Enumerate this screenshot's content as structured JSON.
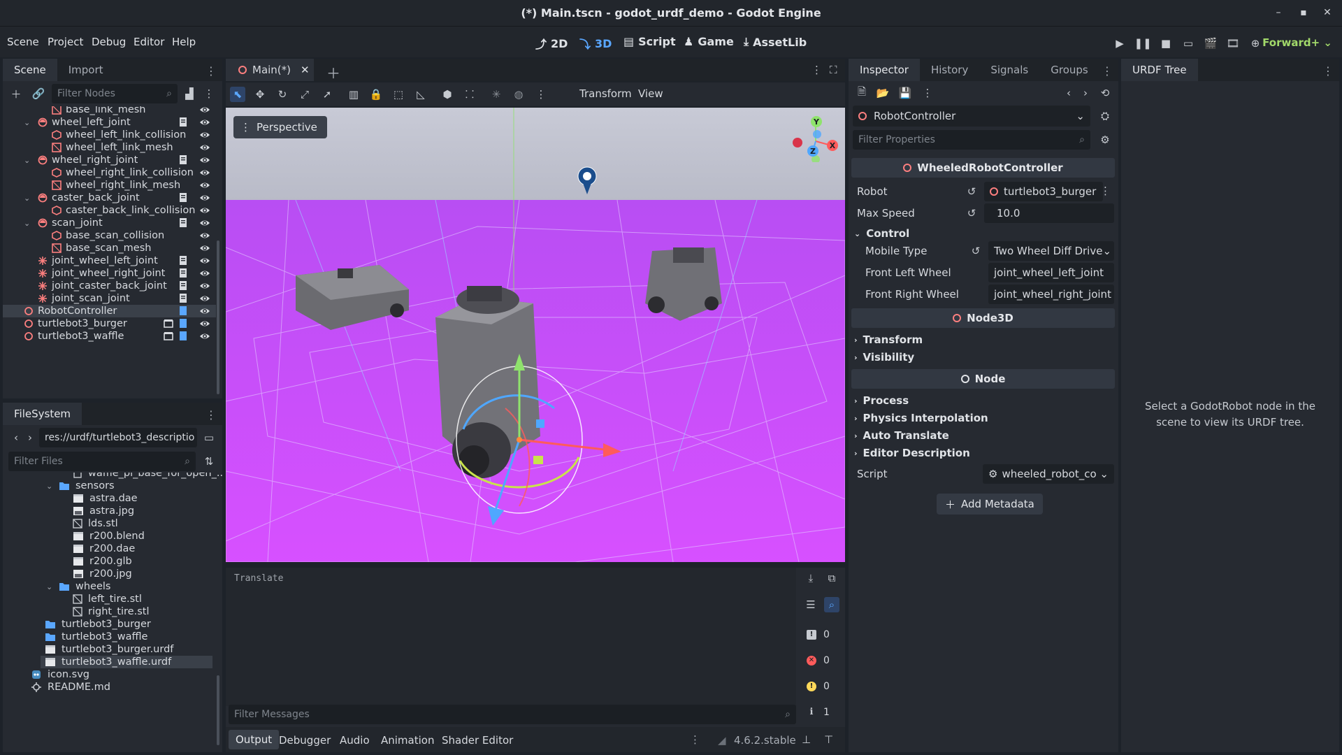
{
  "window": {
    "title": "(*) Main.tscn - godot_urdf_demo - Godot Engine"
  },
  "menu": [
    "Scene",
    "Project",
    "Debug",
    "Editor",
    "Help"
  ],
  "workspaces": {
    "w2d": "2D",
    "w3d": "3D",
    "script": "Script",
    "game": "Game",
    "assetlib": "AssetLib"
  },
  "renderer": "Forward+",
  "scene_dock": {
    "tabs": [
      "Scene",
      "Import"
    ],
    "filter_placeholder": "Filter Nodes",
    "nodes": [
      {
        "label": "base_link_mesh",
        "depth": 2,
        "type": "mesh"
      },
      {
        "label": "wheel_left_joint",
        "depth": 1,
        "type": "joint",
        "expanded": true
      },
      {
        "label": "wheel_left_link_collision",
        "depth": 2,
        "type": "collision"
      },
      {
        "label": "wheel_left_link_mesh",
        "depth": 2,
        "type": "mesh"
      },
      {
        "label": "wheel_right_joint",
        "depth": 1,
        "type": "joint",
        "expanded": true
      },
      {
        "label": "wheel_right_link_collision",
        "depth": 2,
        "type": "collision"
      },
      {
        "label": "wheel_right_link_mesh",
        "depth": 2,
        "type": "mesh"
      },
      {
        "label": "caster_back_joint",
        "depth": 1,
        "type": "joint",
        "expanded": true
      },
      {
        "label": "caster_back_link_collision",
        "depth": 2,
        "type": "collision"
      },
      {
        "label": "scan_joint",
        "depth": 1,
        "type": "joint",
        "expanded": true
      },
      {
        "label": "base_scan_collision",
        "depth": 2,
        "type": "collision"
      },
      {
        "label": "base_scan_mesh",
        "depth": 2,
        "type": "mesh"
      },
      {
        "label": "joint_wheel_left_joint",
        "depth": 1,
        "type": "pin"
      },
      {
        "label": "joint_wheel_right_joint",
        "depth": 1,
        "type": "pin"
      },
      {
        "label": "joint_caster_back_joint",
        "depth": 1,
        "type": "pin"
      },
      {
        "label": "joint_scan_joint",
        "depth": 1,
        "type": "pin"
      },
      {
        "label": "RobotController",
        "depth": 0,
        "type": "node",
        "selected": true
      },
      {
        "label": "turtlebot3_burger",
        "depth": 0,
        "type": "node"
      },
      {
        "label": "turtlebot3_waffle",
        "depth": 0,
        "type": "node"
      }
    ]
  },
  "filesystem": {
    "tab": "FileSystem",
    "path": "res://urdf/turtlebot3_descriptio",
    "filter_placeholder": "Filter Files",
    "items": [
      {
        "label": "waffle_pi_base_for_open_...",
        "depth": 3,
        "type": "file"
      },
      {
        "label": "sensors",
        "depth": 2,
        "type": "folder"
      },
      {
        "label": "astra.dae",
        "depth": 3,
        "type": "scene"
      },
      {
        "label": "astra.jpg",
        "depth": 3,
        "type": "image"
      },
      {
        "label": "lds.stl",
        "depth": 3,
        "type": "mesh"
      },
      {
        "label": "r200.blend",
        "depth": 3,
        "type": "scene"
      },
      {
        "label": "r200.dae",
        "depth": 3,
        "type": "scene"
      },
      {
        "label": "r200.glb",
        "depth": 3,
        "type": "scene"
      },
      {
        "label": "r200.jpg",
        "depth": 3,
        "type": "image"
      },
      {
        "label": "wheels",
        "depth": 2,
        "type": "folder"
      },
      {
        "label": "left_tire.stl",
        "depth": 3,
        "type": "mesh"
      },
      {
        "label": "right_tire.stl",
        "depth": 3,
        "type": "mesh"
      },
      {
        "label": "turtlebot3_burger",
        "depth": 1,
        "type": "folder"
      },
      {
        "label": "turtlebot3_waffle",
        "depth": 1,
        "type": "folder"
      },
      {
        "label": "turtlebot3_burger.urdf",
        "depth": 1,
        "type": "doc"
      },
      {
        "label": "turtlebot3_waffle.urdf",
        "depth": 1,
        "type": "doc",
        "selected": true
      },
      {
        "label": "icon.svg",
        "depth": 0,
        "type": "svg"
      },
      {
        "label": "README.md",
        "depth": 0,
        "type": "md"
      }
    ]
  },
  "editor": {
    "tab_label": "Main(*)",
    "menus": {
      "transform": "Transform",
      "view": "View"
    },
    "perspective": "Perspective"
  },
  "gizmo_axes": {
    "x": "X",
    "y": "Y",
    "z": "Z"
  },
  "output": {
    "log_text": "Translate",
    "filter_placeholder": "Filter Messages",
    "counts": {
      "messages": "0",
      "errors": "0",
      "warnings": "0",
      "info": "1"
    },
    "bottom_tabs": [
      "Output",
      "Debugger",
      "Audio",
      "Animation",
      "Shader Editor"
    ],
    "version": "4.6.2.stable"
  },
  "inspector": {
    "tabs": [
      "Inspector",
      "History",
      "Signals",
      "Groups"
    ],
    "object": "RobotController",
    "filter_placeholder": "Filter Properties",
    "class_header": "WheeledRobotController",
    "robot_label": "Robot",
    "robot_value": "turtlebot3_burger",
    "max_speed_label": "Max Speed",
    "max_speed_value": "10.0",
    "control_section": "Control",
    "mobile_type_label": "Mobile Type",
    "mobile_type_value": "Two Wheel Diff Drive",
    "front_left_label": "Front Left Wheel",
    "front_left_value": "joint_wheel_left_joint",
    "front_right_label": "Front Right Wheel",
    "front_right_value": "joint_wheel_right_joint",
    "node3d_header": "Node3D",
    "transform_section": "Transform",
    "visibility_section": "Visibility",
    "node_header": "Node",
    "process_section": "Process",
    "physics_interp_section": "Physics Interpolation",
    "auto_translate_section": "Auto Translate",
    "editor_desc_section": "Editor Description",
    "script_label": "Script",
    "script_value": "wheeled_robot_co",
    "add_metadata": "Add Metadata"
  },
  "urdf_tree": {
    "tab": "URDF Tree",
    "hint": "Select a GodotRobot node in the scene to view its URDF tree."
  },
  "colors": {
    "accent": "#5aa7ff",
    "node_red": "#fc7f7f",
    "renderer_green": "#a2d96a",
    "viewport_floor": "#c44dfc",
    "sky": "#c7c9d6"
  }
}
